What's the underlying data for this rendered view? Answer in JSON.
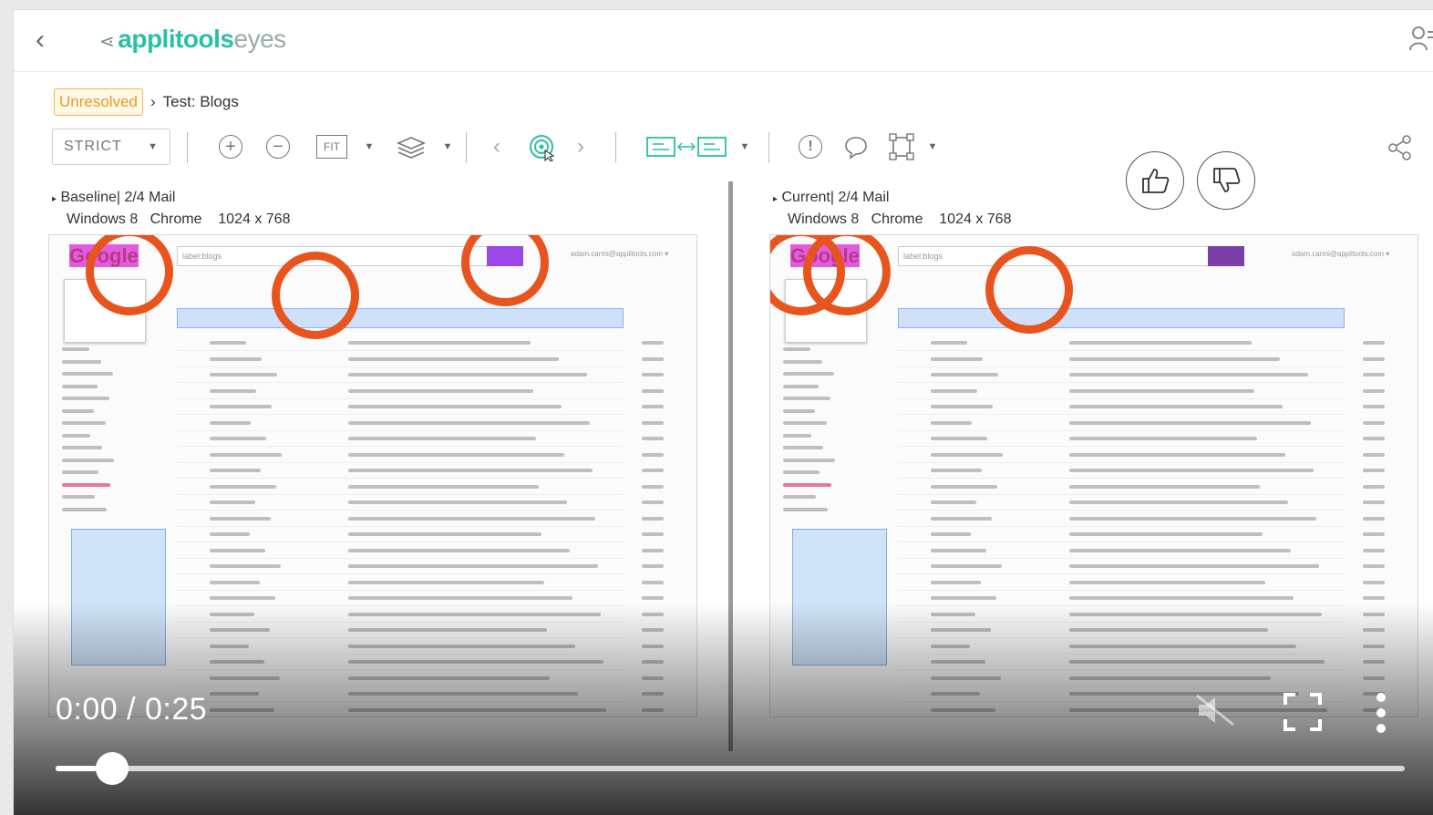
{
  "app": {
    "brand_bold": "applitools",
    "brand_light": "eyes"
  },
  "breadcrumb": {
    "status": "Unresolved",
    "separator": "›",
    "test_label": "Test: Blogs"
  },
  "toolbar": {
    "match_level": "STRICT",
    "fit_label": "FIT"
  },
  "baseline": {
    "title": "Baseline",
    "meta": "| 2/4 Mail",
    "os": "Windows 8",
    "browser": "Chrome",
    "viewport": "1024 x 768"
  },
  "current": {
    "title": "Current",
    "meta": "| 2/4 Mail",
    "os": "Windows 8",
    "browser": "Chrome",
    "viewport": "1024 x 768"
  },
  "gmail": {
    "logo": "Go",
    "logo_highlight": "ogle",
    "search": "label:blogs",
    "account": "adam.carmi@applitools.com ▾"
  },
  "video": {
    "time": "0:00 / 0:25",
    "progress": 0.03
  },
  "colors": {
    "accent": "#2bbfa6",
    "ring": "#e8541e",
    "status": "#e99a25"
  }
}
